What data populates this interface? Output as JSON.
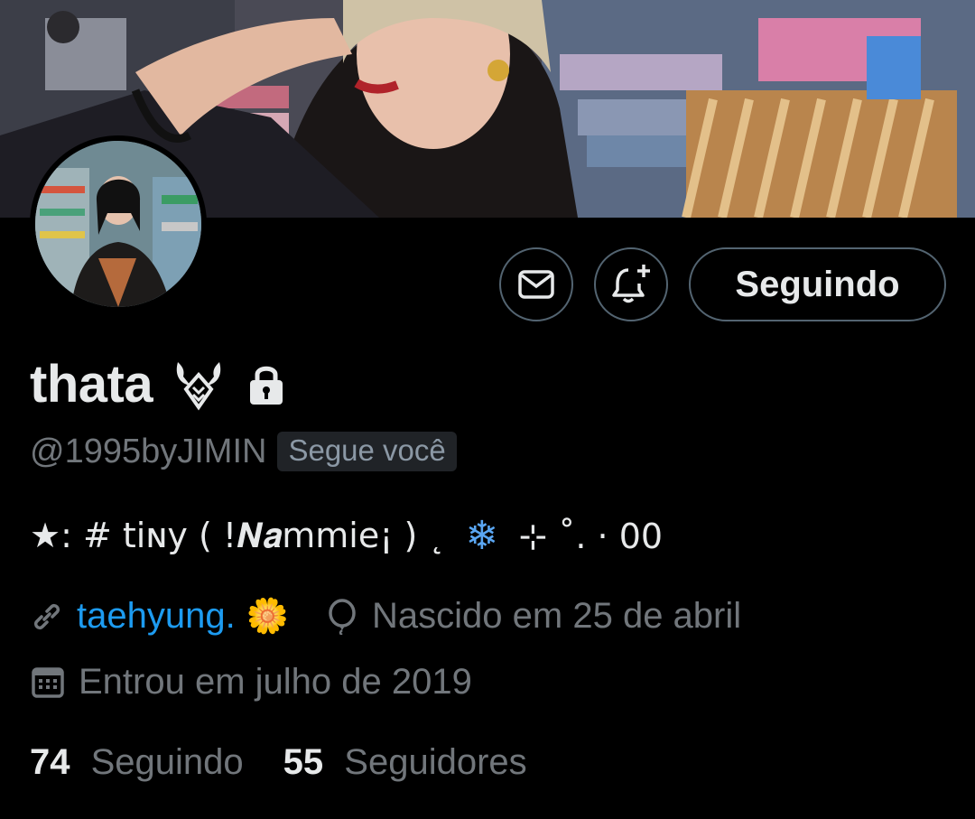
{
  "profile": {
    "name": "thata",
    "handle": "@1995byJIMIN",
    "follows_you": "Segue você",
    "bio_prefix": "★: # tiɴy ( !𝑵𝒂mmie¡ ) ˛ ",
    "bio_snow": "❄",
    "bio_suffix": " ⊹ ˚. · 00",
    "link_text": "taehyung.",
    "link_emoji": "🌼",
    "birthday": "Nascido em 25 de abril",
    "joined": "Entrou em julho de 2019"
  },
  "actions": {
    "follow_label": "Seguindo"
  },
  "stats": {
    "following_count": "74",
    "following_label": "Seguindo",
    "followers_count": "55",
    "followers_label": "Seguidores"
  },
  "colors": {
    "background": "#000000",
    "text": "#e7e9ea",
    "muted": "#71767b",
    "link": "#1d9bf0",
    "border": "#536471"
  },
  "icons": [
    "mail-icon",
    "notification-bell-plus-icon",
    "link-icon",
    "balloon-icon",
    "calendar-icon",
    "lock-icon",
    "emblem-icon"
  ]
}
